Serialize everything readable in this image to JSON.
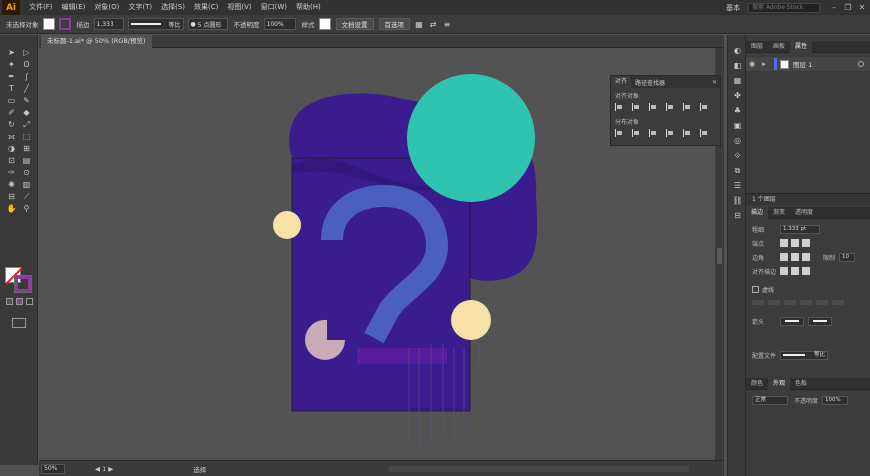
{
  "menubar": {
    "logo": "Ai",
    "items": [
      "文件(F)",
      "编辑(E)",
      "对象(O)",
      "文字(T)",
      "选择(S)",
      "效果(C)",
      "视图(V)",
      "窗口(W)",
      "帮助(H)"
    ],
    "workspace": "基本",
    "search_placeholder": "搜索 Adobe Stock"
  },
  "controlbar": {
    "selection_label": "未选择对象",
    "stroke_label": "描边",
    "stroke_weight": "1.333",
    "stroke_style": "等比",
    "brush_label": "5 点圆形",
    "opacity_label": "不透明度",
    "opacity_value": "100%",
    "style_label": "样式",
    "doc_setup_button": "文档设置",
    "prefs_button": "首选项"
  },
  "document": {
    "tab_title": "未标题-1.ai* @ 50% (RGB/预览)",
    "zoom": "50%",
    "tool_status": "选择"
  },
  "align_panel": {
    "tabs": [
      "对齐",
      "路径查找器"
    ],
    "align_objects_label": "对齐对象",
    "distribute_objects_label": "分布对象"
  },
  "layers_panel": {
    "tabs": [
      "图层",
      "画板",
      "属性"
    ],
    "layer_name": "图层 1",
    "layer_count": "1 个图层"
  },
  "stroke_panel": {
    "tabs": [
      "描边",
      "渐变",
      "透明度"
    ],
    "weight_label": "粗细",
    "weight_value": "1.333 pt",
    "cap_label": "端点",
    "corner_label": "边角",
    "limit_label": "限制",
    "limit_value": "10",
    "align_label": "对齐描边",
    "dashed_label": "虚线",
    "arrowheads_label": "箭头",
    "profile_label": "配置文件",
    "profile_value": "等比"
  },
  "appearance_panel": {
    "tabs": [
      "颜色",
      "外观",
      "色板"
    ],
    "blend_mode": "正常",
    "opacity_label": "不透明度",
    "opacity_value": "100%"
  },
  "colors": {
    "purple": "#3b1c8f",
    "teal": "#2ec4b0",
    "cream": "#f5e2a4",
    "pink": "#c9aab7",
    "blue": "#4a5fc0"
  }
}
